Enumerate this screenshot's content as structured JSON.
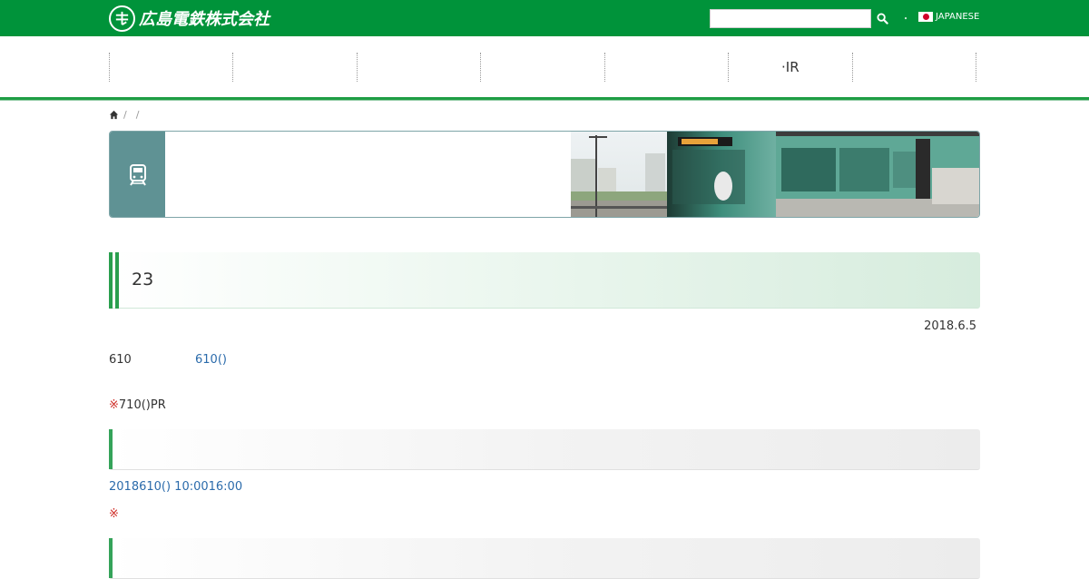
{
  "header": {
    "logo_text": "広島電鉄株式会社",
    "search": {
      "value": "",
      "placeholder": ""
    },
    "separator": "・",
    "language_label": "JAPANESE"
  },
  "nav": {
    "items": [
      "",
      "",
      "",
      "",
      "",
      "·IR",
      ""
    ]
  },
  "breadcrumb": {
    "sep1": "/",
    "sep2": "/"
  },
  "article": {
    "title": "23",
    "date": "2018.6.5",
    "line1_text": "610",
    "line1_link": "610()",
    "note1_mark": "※",
    "note1_text": "710()PR",
    "datetime_link": "2018610() 10:0016:00",
    "note2_mark": "※"
  },
  "colors": {
    "brand_green": "#00933a",
    "accent_bar": "#2a9f4e",
    "hero_icon_bg": "#5f9294",
    "link_blue": "#2b6bab",
    "note_red": "#d0302a"
  },
  "icons": {
    "logo": "hiroden-logo-mark",
    "search": "search-icon",
    "flag": "japan-flag-icon",
    "home": "home-icon",
    "train": "train-icon"
  }
}
